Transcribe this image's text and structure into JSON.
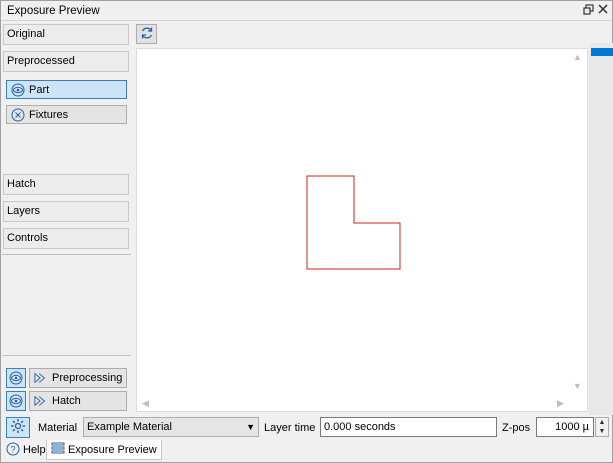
{
  "window": {
    "title": "Exposure Preview"
  },
  "titlebar_icons": [
    "float-icon",
    "close-icon"
  ],
  "left_panel": {
    "sections": [
      "Original",
      "Preprocessed",
      "Hatch",
      "Layers",
      "Controls"
    ],
    "preprocessed_items": [
      {
        "label": "Part",
        "icon": "eye-icon",
        "selected": true
      },
      {
        "label": "Fixtures",
        "icon": "circle-x-icon",
        "selected": false
      }
    ],
    "actions": [
      {
        "label": "Preprocessing",
        "icon": "play-icon"
      },
      {
        "label": "Hatch",
        "icon": "play-icon"
      }
    ]
  },
  "viewport": {
    "reload_icon": "reload-icon",
    "shape_color": "#d41c1c"
  },
  "bottom_bar": {
    "material_label": "Material",
    "material_value": "Example Material",
    "layer_time_label": "Layer time",
    "layer_time_value": "0.000 seconds",
    "zpos_label": "Z-pos",
    "zpos_value": "1000 µ"
  },
  "tabs": [
    {
      "label": "Help",
      "icon": "help-icon"
    },
    {
      "label": "Exposure Preview",
      "icon": "list-icon",
      "active": true
    }
  ],
  "colors": {
    "accent": "#0078d7",
    "selection": "#cce4f7"
  }
}
